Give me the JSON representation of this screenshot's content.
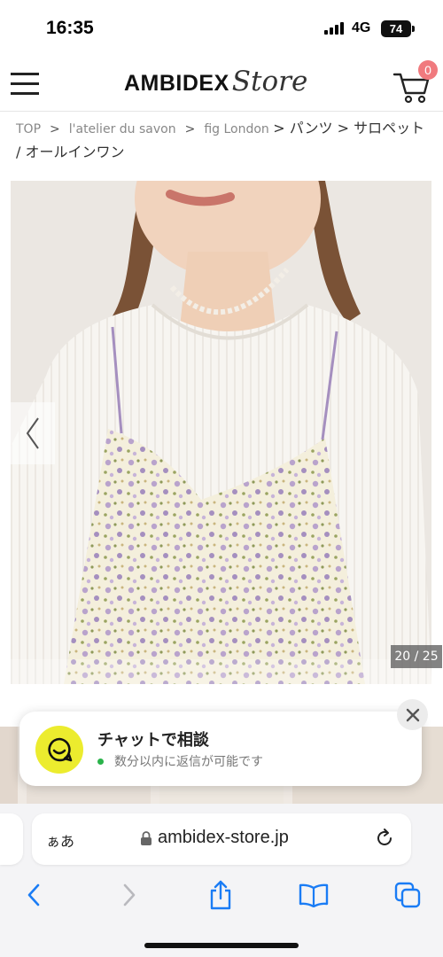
{
  "status_bar": {
    "time": "16:35",
    "network": "4G",
    "battery": "74"
  },
  "header": {
    "logo_main": "AMBIDEX",
    "logo_script": "Store",
    "cart_count": "0"
  },
  "breadcrumb": {
    "items": [
      "TOP",
      "l'atelier du savon",
      "fig London"
    ],
    "separator": ">",
    "category": "> パンツ > サロペット / オールインワン"
  },
  "gallery": {
    "counter": "20 / 25"
  },
  "chat": {
    "title": "チャットで相談",
    "status": "数分以内に返信が可能です"
  },
  "browser": {
    "aa_label": "ぁあ",
    "url": "ambidex-store.jp"
  },
  "colors": {
    "accent_badge": "#f07a7e",
    "chat_icon_bg": "#ecec2e",
    "online_dot": "#2ab34a",
    "safari_blue": "#1a7cf5"
  }
}
